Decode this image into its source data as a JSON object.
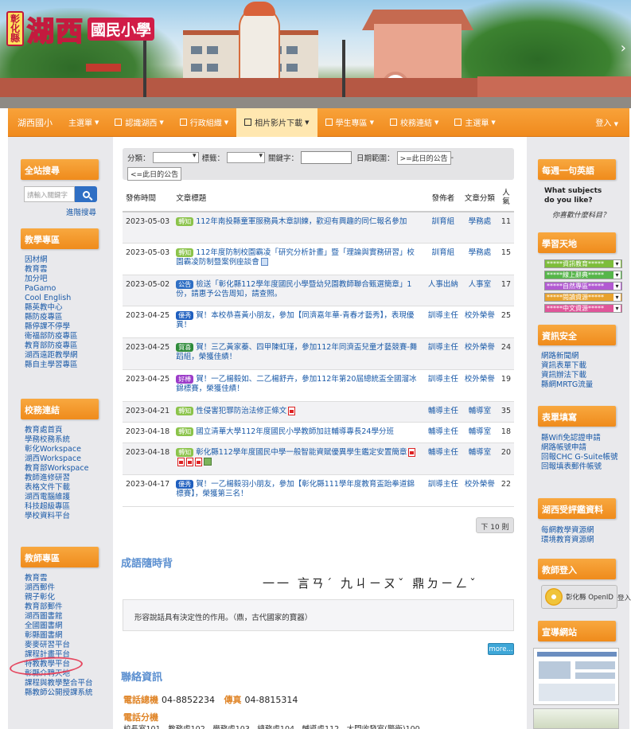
{
  "logo": {
    "county": "彰化縣",
    "name": "湖西",
    "sub": "國民小學"
  },
  "nav": {
    "brand": "湖西國小",
    "items": [
      {
        "label": "主選單"
      },
      {
        "label": "認識湖西"
      },
      {
        "label": "行政組織"
      },
      {
        "label": "相片影片下載",
        "active": true
      },
      {
        "label": "學生專區"
      },
      {
        "label": "校務連結"
      },
      {
        "label": "主選單"
      }
    ],
    "login": "登入"
  },
  "left": {
    "search_title": "全站搜尋",
    "search_placeholder": "請輸入關鍵字",
    "advanced": "進階搜尋",
    "teaching_title": "教學專區",
    "teaching": [
      "因材網",
      "教育雲",
      "加分吧",
      "PaGamo",
      "Cool English",
      "縣英教中心",
      "縣防疫專區",
      "縣停課不停學",
      "衛福部防疫專區",
      "教育部防疫專區",
      "湖西遠距教學網",
      "縣自主學習專區"
    ],
    "admin_title": "校務連結",
    "admin": [
      "教育處首頁",
      "學務校務系統",
      "彰化Workspace",
      "湖西Workspace",
      "教育部Workspace",
      "教師進修研習",
      "表格文件下載",
      "湖西電腦維護",
      "科技超級專區",
      "學校資料平台"
    ],
    "teacher_title": "教師專區",
    "teacher": [
      "教育雲",
      "湖西郵件",
      "親子彰化",
      "教育部郵件",
      "湖西圖書館",
      "全國圖書網",
      "彰縣圖書網",
      "麥麥研習平台",
      "課程計畫平台",
      "特教教學平台",
      "彰縣介聘天地",
      "課程與教學整合平台",
      "縣教師公開授課系統"
    ]
  },
  "filter": {
    "cat_label": "分類：",
    "tag_label": "標籤：",
    "keyword_label": "關鍵字：",
    "range_label": "日期範圍：",
    "after_btn": ">=此日的公告",
    "sep": "-",
    "before_btn": "<=此日的公告"
  },
  "table": {
    "headers": {
      "date": "發佈時間",
      "title": "文章標題",
      "pub": "發佈者",
      "cat": "文章分類",
      "views": "人氣"
    },
    "rows": [
      {
        "date": "2023-05-03",
        "badge": "轉知",
        "color": "#8bc34a",
        "title": "112年南投縣童軍服務員木章訓練，歡迎有興趣的同仁報名參加",
        "pub": "訓育組",
        "cat": "學務處",
        "views": "11",
        "icons": []
      },
      {
        "date": "2023-05-03",
        "badge": "轉知",
        "color": "#8bc34a",
        "title": "112年度防制校園霸凌「研究分析計畫」暨「理論與實務研習」校園霸凌防制暨案例座談會",
        "pub": "訓育組",
        "cat": "學務處",
        "views": "15",
        "icons": [
          "doc"
        ]
      },
      {
        "date": "2023-05-02",
        "badge": "公告",
        "color": "#2f6fc4",
        "title": "檢送「彰化縣112學年度國民小學暨幼兒園教師聯合甄選簡章」1份，請惠予公告周知，請查照。",
        "pub": "人事出納",
        "cat": "人事室",
        "views": "17",
        "icons": []
      },
      {
        "date": "2023-04-25",
        "badge": "優秀",
        "color": "#1f5fbf",
        "title": "賀！本校恭喜黃小朋友，參加【同濟嘉年華-青春才藝秀】，表現優異！",
        "pub": "訓導主任",
        "cat": "校外榮譽",
        "views": "25",
        "icons": []
      },
      {
        "date": "2023-04-25",
        "badge": "賀喜",
        "color": "#2e8b3a",
        "title": "賀！三乙黃家蓁、四甲陳虹瑾，參加112年同濟盃兒童才藝競賽-舞蹈組，榮獲佳績！",
        "pub": "訓導主任",
        "cat": "校外榮譽",
        "views": "24",
        "icons": []
      },
      {
        "date": "2023-04-25",
        "badge": "好棒",
        "color": "#9c3cc9",
        "title": "賀！一乙楊毅如、二乙楊舒卉，參加112年第20屆總統盃全國溜冰錦標賽，榮獲佳績！",
        "pub": "訓導主任",
        "cat": "校外榮譽",
        "views": "19",
        "icons": []
      },
      {
        "date": "2023-04-21",
        "badge": "轉知",
        "color": "#8bc34a",
        "title": "性侵害犯罪防治法修正條文",
        "pub": "輔導主任",
        "cat": "輔導室",
        "views": "35",
        "icons": [
          "pdf"
        ]
      },
      {
        "date": "2023-04-18",
        "badge": "轉知",
        "color": "#8bc34a",
        "title": "國立清華大學112年度國民小學教師加註輔導專長24學分班",
        "pub": "輔導主任",
        "cat": "輔導室",
        "views": "18",
        "icons": []
      },
      {
        "date": "2023-04-18",
        "badge": "轉知",
        "color": "#8bc34a",
        "title": "彰化縣112學年度國民中學一般智能資賦優異學生鑑定安置簡章",
        "pub": "輔導主任",
        "cat": "輔導室",
        "views": "20",
        "icons": [
          "pdf",
          "pdf",
          "pdf",
          "pdf",
          "img"
        ]
      },
      {
        "date": "2023-04-17",
        "badge": "優秀",
        "color": "#1f5fbf",
        "title": "賀！一乙楊毅羽小朋友，參加【彰化縣111學年度教育盃跆拳道錦標賽】，榮獲第三名！",
        "pub": "訓導主任",
        "cat": "校外榮譽",
        "views": "22",
        "icons": []
      }
    ],
    "next": "下 10 則"
  },
  "idiom": {
    "heading": "成語隨時背",
    "phrase": "一言九鼎",
    "phrase_zhuyin": "一一 言ㄢˊ 九ㄐㄧㄡˇ 鼎ㄉㄧㄥˇ",
    "meaning": "形容說話具有決定性的作用。（鼎，古代國家的寶器）",
    "more": "more..."
  },
  "contact": {
    "heading": "聯絡資訊",
    "phone_label": "電話總機",
    "phone": "04-8852234",
    "fax_label": "傳真",
    "fax": "04-8815314",
    "ext_label": "電話分機",
    "ext_line": "校長室101　教務處102　學務處103　總務處104　輔導處112　大門收發室(警衛)100"
  },
  "right": {
    "english_title": "每週一句英語",
    "english_q": "What subjects do you like?",
    "english_a": "你喜歡什麼科目？",
    "learn_title": "學習天地",
    "learn_dd": [
      {
        "label": "*****資訊教育*****",
        "color": "#7dbd3a"
      },
      {
        "label": "*****線上辭典*****",
        "color": "#56b64a"
      },
      {
        "label": "*****自然專區*****",
        "color": "#b25ad2"
      },
      {
        "label": "*****閱讀資源*****",
        "color": "#e8a22d"
      },
      {
        "label": "*****中文資源*****",
        "color": "#e0559a"
      }
    ],
    "security_title": "資訊安全",
    "security": [
      "網路新聞網",
      "資訊表單下載",
      "資訊辦法下載",
      "縣網MRTG流量"
    ],
    "forms_title": "表單填寫",
    "forms": [
      "縣Wifi免認證申請",
      "網路帳號申請",
      "回報CHC G-Suite帳號",
      "回報填表郵件帳號"
    ],
    "eval_title": "湖西受評鑑資料",
    "eval": [
      "每網教學資源網",
      "環境教育資源網"
    ],
    "teacher_login_title": "教師登入",
    "openid": "彰化縣 OpenID",
    "openid_after": "登入",
    "promo_title": "宣導網站"
  },
  "colors": {
    "accent": "#f08a1d",
    "link": "#1a5aa8",
    "heading_blue": "#5b8fd0"
  }
}
